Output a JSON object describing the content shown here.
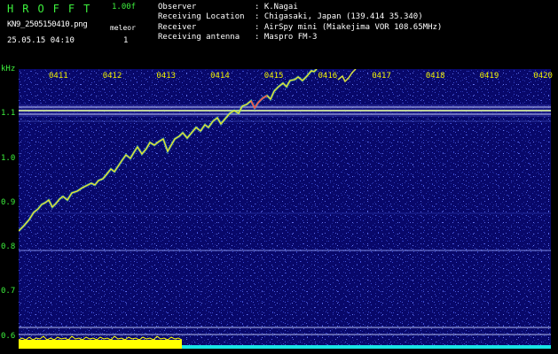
{
  "header": {
    "title": "HROFFT",
    "version": "1.00f",
    "filename": "KN9_2505150410.png",
    "unit": "meleor",
    "date": "25.05.15 04:10",
    "count": "1"
  },
  "meta": [
    {
      "label": "Observer",
      "value": ": K.Nagai"
    },
    {
      "label": "Receiving Location",
      "value": ": Chigasaki, Japan (139.414 35.340)"
    },
    {
      "label": "Receiver",
      "value": ": AirSpy mini (Miakejima VOR 108.65MHz)"
    },
    {
      "label": "Receiving antenna",
      "value": ": Maspro FM-3"
    }
  ],
  "axis": {
    "unit": "kHz",
    "freq_labels": [
      "1.1",
      "1.0",
      "0.9",
      "0.8",
      "0.7",
      "0.6"
    ],
    "time_labels": [
      "0411",
      "0412",
      "0413",
      "0414",
      "0415",
      "0416",
      "0417",
      "0418",
      "0419",
      "0420"
    ]
  },
  "colors": {
    "background": "#000000",
    "spectrogram": "#08086a",
    "label_green": "#3df03d",
    "label_yellow": "#f0f000",
    "trace_yellow": "#e8e830",
    "signal_bar_yellow": "#ffff00",
    "signal_bar_cyan": "#18e6e6"
  }
}
